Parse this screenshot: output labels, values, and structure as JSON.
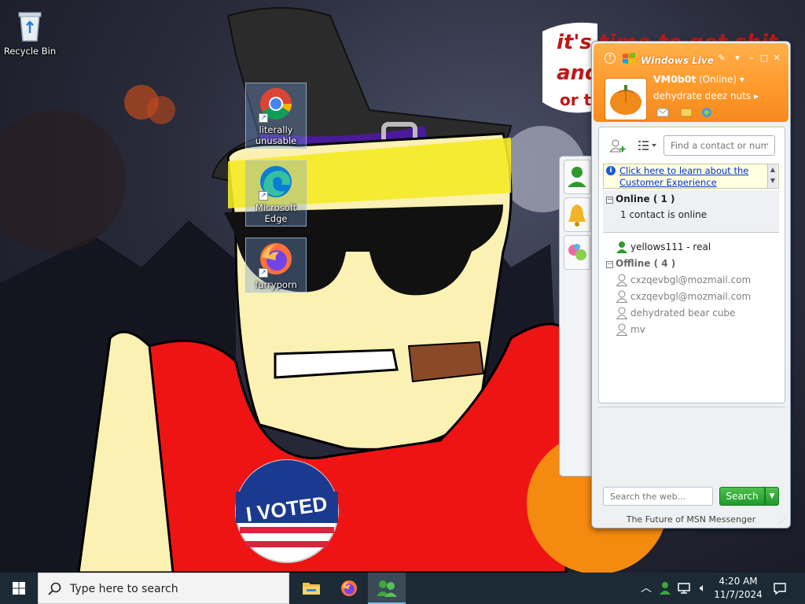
{
  "desktop": {
    "icons": [
      {
        "label": "Recycle Bin",
        "icon": "recycle-bin-icon"
      },
      {
        "label": "literally unusable",
        "icon": "chrome-icon"
      },
      {
        "label": "Microsoft Edge",
        "icon": "edge-icon"
      },
      {
        "label": "furryporn",
        "icon": "firefox-icon"
      }
    ],
    "wallpaper_text": {
      "line1": "it's time to get shit",
      "line2": "and",
      "line3": "or t"
    },
    "sticker_text": "I VOTED"
  },
  "msn": {
    "title": "Windows Live",
    "user": {
      "name": "VM0b0t",
      "status": "(Online)",
      "personal_message": "dehydrate deez nuts"
    },
    "find_placeholder": "Find a contact or number...",
    "info_link": "Click here to learn about the Customer Experience",
    "groups": {
      "online": {
        "header": "Online ( 1 )",
        "summary": "1 contact is online",
        "contacts": [
          "yellows111 - real"
        ]
      },
      "offline": {
        "header": "Offline ( 4 )",
        "contacts": [
          "cxzqevbgl@mozmail.com",
          "cxzqevbgl@mozmail.com",
          "dehydrated bear cube",
          "mv"
        ]
      }
    },
    "search_placeholder": "Search the web...",
    "search_button": "Search",
    "footer": "The Future of MSN Messenger",
    "colors": {
      "header_orange": "#ff9a2c",
      "search_green": "#1f9a2a",
      "link_blue": "#0033cc"
    }
  },
  "taskbar": {
    "search_placeholder": "Type here to search",
    "apps": [
      "file-explorer-icon",
      "firefox-icon",
      "msn-messenger-icon"
    ],
    "clock": {
      "time": "4:20 AM",
      "date": "11/7/2024"
    }
  }
}
